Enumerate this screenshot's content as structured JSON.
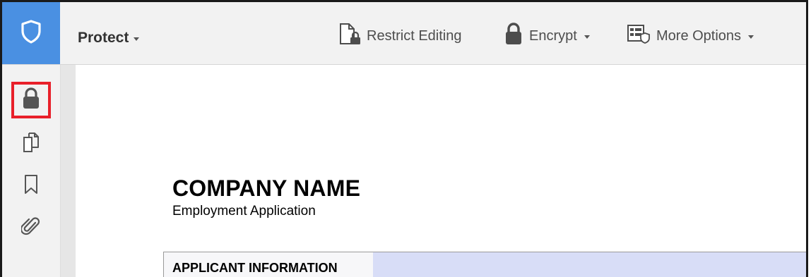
{
  "toolbar": {
    "protect_label": "Protect",
    "restrict_label": "Restrict Editing",
    "encrypt_label": "Encrypt",
    "more_label": "More Options"
  },
  "sidebar": {
    "items": [
      {
        "icon": "lock-icon",
        "highlighted": true
      },
      {
        "icon": "copy-pages-icon"
      },
      {
        "icon": "bookmark-icon"
      },
      {
        "icon": "paperclip-icon"
      }
    ],
    "highlight_color": "#e8202a"
  },
  "document": {
    "company_name": "COMPANY NAME",
    "subtitle": "Employment Application",
    "section_title": "APPLICANT INFORMATION"
  },
  "colors": {
    "accent": "#4a90e2",
    "section_fill": "#d8ddf7"
  }
}
